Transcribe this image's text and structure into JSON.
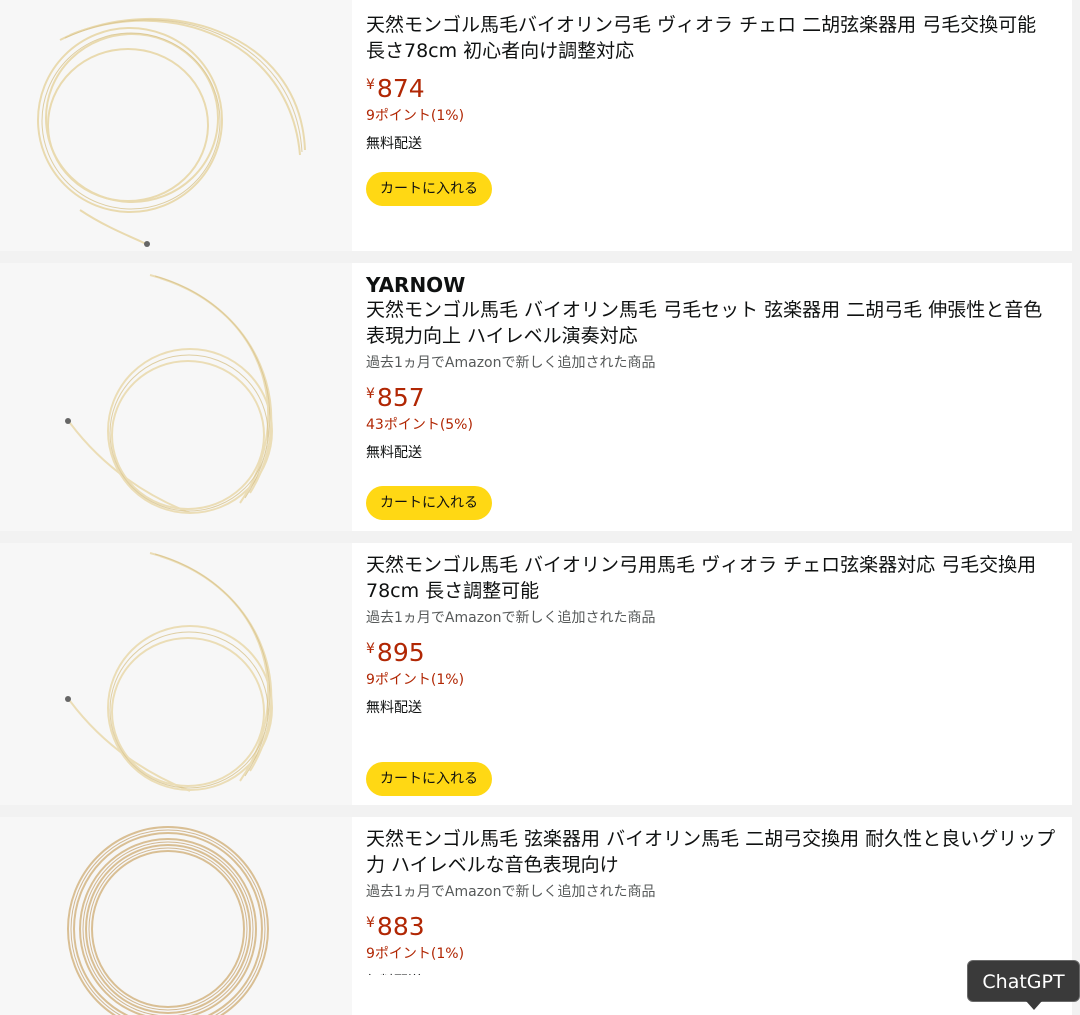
{
  "products": [
    {
      "brand": "",
      "title": "天然モンゴル馬毛バイオリン弓毛 ヴィオラ チェロ 二胡弦楽器用 弓毛交換可能 長さ78cm 初心者向け調整対応",
      "note": "",
      "price": "874",
      "points": "9ポイント(1%)",
      "shipping": "無料配送",
      "cart_label": "カートに入れる"
    },
    {
      "brand": "YARNOW",
      "title": "天然モンゴル馬毛 バイオリン馬毛 弓毛セット 弦楽器用 二胡弓毛 伸張性と音色表現力向上 ハイレベル演奏対応",
      "note": "過去1ヵ月でAmazonで新しく追加された商品",
      "price": "857",
      "points": "43ポイント(5%)",
      "shipping": "無料配送",
      "cart_label": "カートに入れる"
    },
    {
      "brand": "",
      "title": "天然モンゴル馬毛 バイオリン弓用馬毛 ヴィオラ チェロ弦楽器対応 弓毛交換用 78cm 長さ調整可能",
      "note": "過去1ヵ月でAmazonで新しく追加された商品",
      "price": "895",
      "points": "9ポイント(1%)",
      "shipping": "無料配送",
      "cart_label": "カートに入れる"
    },
    {
      "brand": "",
      "title": "天然モンゴル馬毛 弦楽器用 バイオリン馬毛 二胡弓交換用 耐久性と良いグリップ力 ハイレベルな音色表現向け",
      "note": "過去1ヵ月でAmazonで新しく追加された商品",
      "price": "883",
      "points": "9ポイント(1%)",
      "shipping": "無料配送",
      "cart_label": ""
    }
  ],
  "currency_symbol": "¥",
  "tooltip": {
    "label": "ChatGPT"
  },
  "colors": {
    "price": "#b12704",
    "cart_button": "#ffd814",
    "background": "#f2f2f2"
  }
}
